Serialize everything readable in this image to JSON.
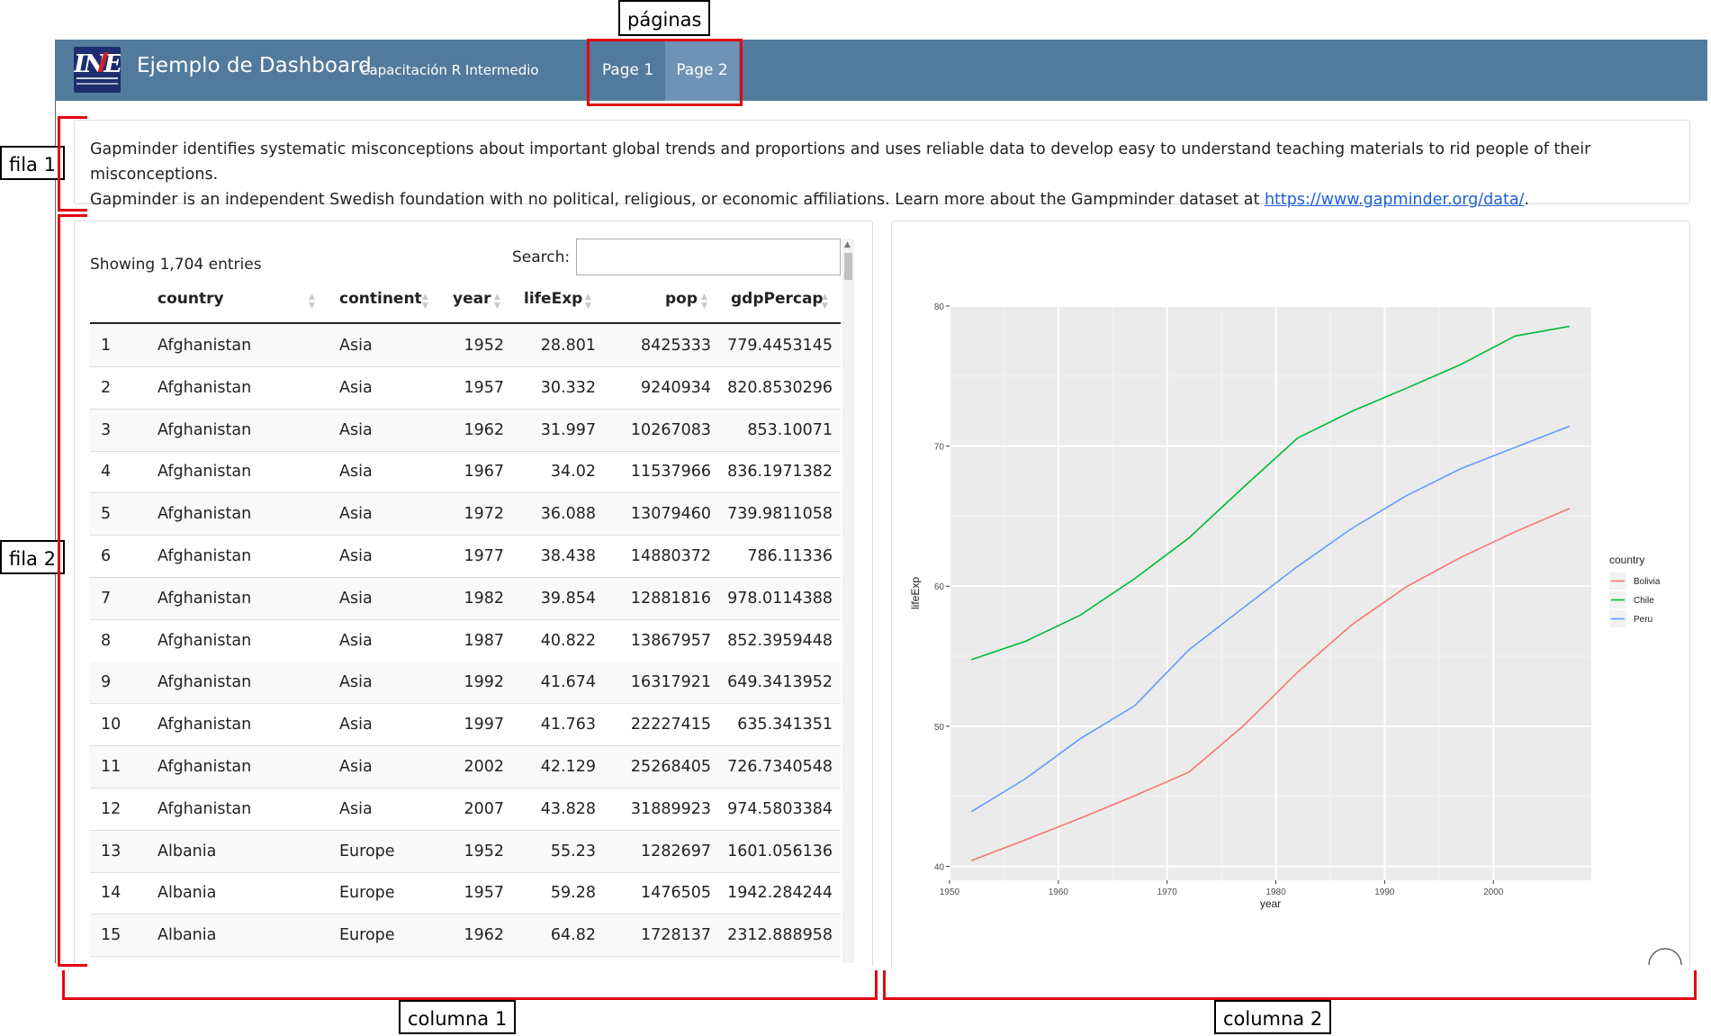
{
  "annotations": {
    "pages": "páginas",
    "row1": "fila 1",
    "row2": "fila 2",
    "col1": "columna 1",
    "col2": "columna 2"
  },
  "navbar": {
    "title": "Ejemplo de Dashboard",
    "subtitle": "Capacitación R Intermedio",
    "logo_text": "INE",
    "tabs": [
      {
        "label": "Page 1",
        "active": false
      },
      {
        "label": "Page 2",
        "active": true
      }
    ]
  },
  "intro": {
    "line1": "Gapminder identifies systematic misconceptions about important global trends and proportions and uses reliable data to develop easy to understand teaching materials to rid people of their misconceptions.",
    "line2_prefix": "Gapminder is an independent Swedish foundation with no political, religious, or economic affiliations. Learn more about the Gampminder dataset at ",
    "link": "https://www.gapminder.org/data/",
    "line2_suffix": "."
  },
  "table": {
    "info": "Showing 1,704 entries",
    "search_label": "Search:",
    "search_value": "",
    "columns": [
      "",
      "country",
      "continent",
      "year",
      "lifeExp",
      "pop",
      "gdpPercap"
    ],
    "rows": [
      [
        "1",
        "Afghanistan",
        "Asia",
        "1952",
        "28.801",
        "8425333",
        "779.4453145"
      ],
      [
        "2",
        "Afghanistan",
        "Asia",
        "1957",
        "30.332",
        "9240934",
        "820.8530296"
      ],
      [
        "3",
        "Afghanistan",
        "Asia",
        "1962",
        "31.997",
        "10267083",
        "853.10071"
      ],
      [
        "4",
        "Afghanistan",
        "Asia",
        "1967",
        "34.02",
        "11537966",
        "836.1971382"
      ],
      [
        "5",
        "Afghanistan",
        "Asia",
        "1972",
        "36.088",
        "13079460",
        "739.9811058"
      ],
      [
        "6",
        "Afghanistan",
        "Asia",
        "1977",
        "38.438",
        "14880372",
        "786.11336"
      ],
      [
        "7",
        "Afghanistan",
        "Asia",
        "1982",
        "39.854",
        "12881816",
        "978.0114388"
      ],
      [
        "8",
        "Afghanistan",
        "Asia",
        "1987",
        "40.822",
        "13867957",
        "852.3959448"
      ],
      [
        "9",
        "Afghanistan",
        "Asia",
        "1992",
        "41.674",
        "16317921",
        "649.3413952"
      ],
      [
        "10",
        "Afghanistan",
        "Asia",
        "1997",
        "41.763",
        "22227415",
        "635.341351"
      ],
      [
        "11",
        "Afghanistan",
        "Asia",
        "2002",
        "42.129",
        "25268405",
        "726.7340548"
      ],
      [
        "12",
        "Afghanistan",
        "Asia",
        "2007",
        "43.828",
        "31889923",
        "974.5803384"
      ],
      [
        "13",
        "Albania",
        "Europe",
        "1952",
        "55.23",
        "1282697",
        "1601.056136"
      ],
      [
        "14",
        "Albania",
        "Europe",
        "1957",
        "59.28",
        "1476505",
        "1942.284244"
      ],
      [
        "15",
        "Albania",
        "Europe",
        "1962",
        "64.82",
        "1728137",
        "2312.888958"
      ]
    ]
  },
  "chart_data": {
    "type": "line",
    "title": "",
    "xlabel": "year",
    "ylabel": "lifeExp",
    "x": [
      1952,
      1957,
      1962,
      1967,
      1972,
      1977,
      1982,
      1987,
      1992,
      1997,
      2002,
      2007
    ],
    "xlim": [
      1950,
      2009
    ],
    "ylim": [
      39,
      80
    ],
    "xticks": [
      1950,
      1960,
      1970,
      1980,
      1990,
      2000
    ],
    "yticks": [
      40,
      50,
      60,
      70,
      80
    ],
    "grid": true,
    "legend_title": "country",
    "legend_position": "right",
    "series": [
      {
        "name": "Bolivia",
        "color": "#f8766d",
        "values": [
          40.41,
          41.89,
          43.43,
          45.03,
          46.71,
          50.02,
          53.86,
          57.25,
          59.96,
          62.05,
          63.88,
          65.55
        ]
      },
      {
        "name": "Chile",
        "color": "#00ba38",
        "values": [
          54.75,
          56.07,
          57.92,
          60.52,
          63.44,
          67.05,
          70.57,
          72.49,
          74.13,
          75.82,
          77.86,
          78.55
        ]
      },
      {
        "name": "Peru",
        "color": "#619cff",
        "values": [
          43.9,
          46.26,
          49.1,
          51.45,
          55.45,
          58.45,
          61.41,
          64.13,
          66.46,
          68.39,
          69.91,
          71.42
        ]
      }
    ]
  }
}
